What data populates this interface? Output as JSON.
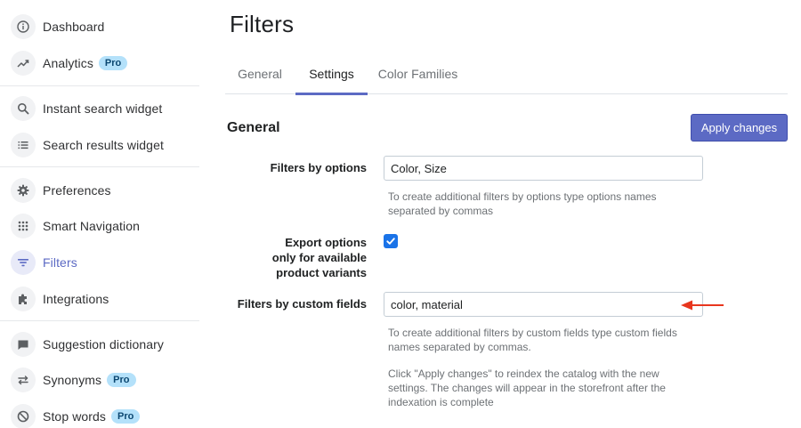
{
  "sidebar": {
    "items": [
      {
        "label": "Dashboard",
        "icon": "info-icon"
      },
      {
        "label": "Analytics",
        "icon": "trending-up-icon",
        "badge": "Pro"
      },
      {
        "label": "Instant search widget",
        "icon": "search-icon"
      },
      {
        "label": "Search results widget",
        "icon": "list-icon"
      },
      {
        "label": "Preferences",
        "icon": "gear-icon"
      },
      {
        "label": "Smart Navigation",
        "icon": "grid-icon"
      },
      {
        "label": "Filters",
        "icon": "filter-icon",
        "active": true
      },
      {
        "label": "Integrations",
        "icon": "puzzle-icon"
      },
      {
        "label": "Suggestion dictionary",
        "icon": "chat-bubble-icon"
      },
      {
        "label": "Synonyms",
        "icon": "swap-arrows-icon",
        "badge": "Pro"
      },
      {
        "label": "Stop words",
        "icon": "block-icon",
        "badge": "Pro"
      }
    ]
  },
  "page": {
    "title": "Filters",
    "tabs": [
      {
        "label": "General"
      },
      {
        "label": "Settings",
        "active": true
      },
      {
        "label": "Color Families"
      }
    ]
  },
  "section": {
    "title": "General",
    "apply_label": "Apply changes"
  },
  "form": {
    "options_label": "Filters by options",
    "options_value": "Color, Size",
    "options_help": "To create additional filters by options type options names separated by commas",
    "export_label_1": "Export options",
    "export_label_2": "only for available",
    "export_label_3": "product variants",
    "export_checked": true,
    "custom_label": "Filters by custom fields",
    "custom_value": "color, material",
    "custom_help": "To create additional filters by custom fields type custom fields names separated by commas.",
    "apply_note": "Click \"Apply changes\" to reindex the catalog with the new settings. The changes will appear in the storefront after the indexation is complete"
  },
  "colors": {
    "accent": "#5c6ac4",
    "checkbox": "#1a73e8",
    "annotation_arrow": "#e8361e",
    "badge_bg": "#b4e1fa"
  }
}
